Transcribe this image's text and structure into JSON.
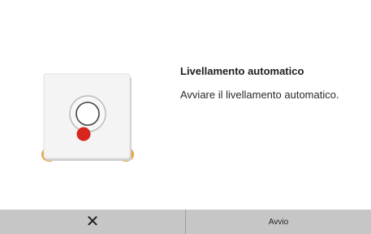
{
  "dialog": {
    "title": "Livellamento automatico",
    "message": "Avviare il livellamento automatico.",
    "illustration_icon": "auto-leveling-bed-icon"
  },
  "footer": {
    "cancel_icon": "close-icon",
    "cancel_glyph": "✕",
    "start_label": "Avvio"
  },
  "colors": {
    "background": "#ffffff",
    "footer_button": "#c6c6c6",
    "probe_red": "#d7261e",
    "bed_feet": "#e7a23a"
  }
}
